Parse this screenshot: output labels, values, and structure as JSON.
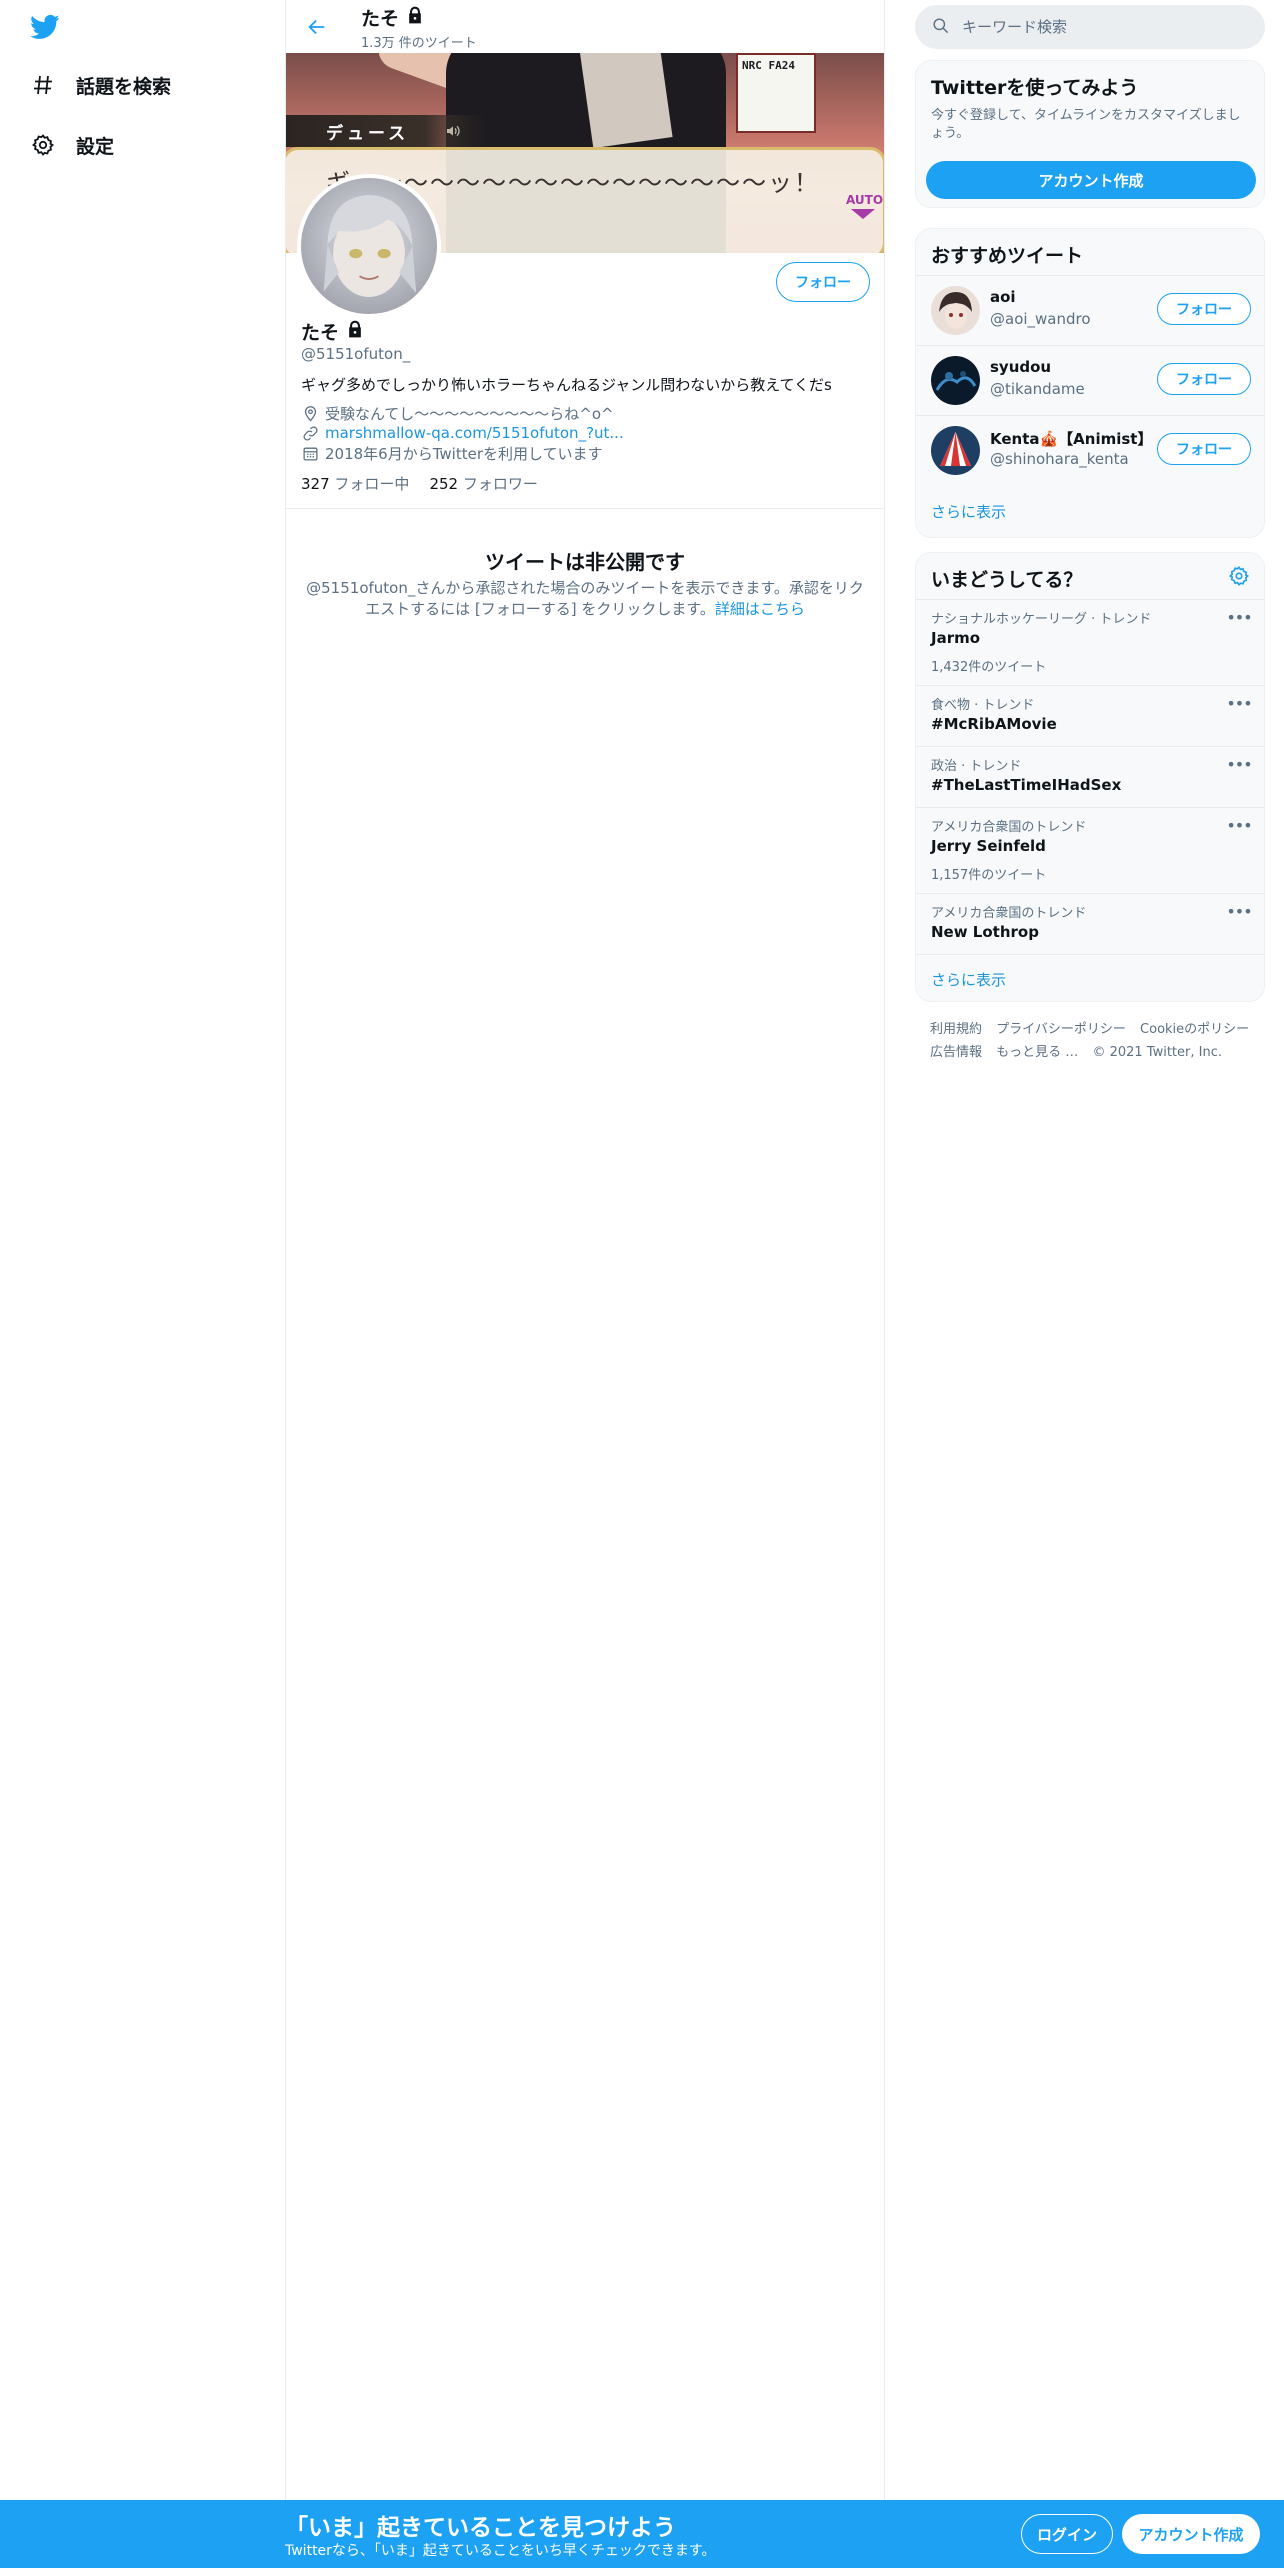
{
  "nav": {
    "logo_icon": "twitter-bird-icon",
    "items": [
      {
        "label": "話題を検索",
        "icon": "hashtag-icon"
      },
      {
        "label": "設定",
        "icon": "gear-icon"
      }
    ]
  },
  "header": {
    "name": "たそ",
    "tweet_count": "1.3万 件のツイート"
  },
  "banner": {
    "speaker": "デュース",
    "dialog": "ギ〜〜〜〜〜〜〜〜〜〜〜〜〜〜〜〜ッ！",
    "auto_label": "AUTO",
    "tag_text": "NRC FA24"
  },
  "profile": {
    "name": "たそ",
    "handle": "@5151ofuton_",
    "follow_label": "フォロー",
    "bio": "ギャグ多めでしっかり怖いホラーちゃんねるジャンル問わないから教えてくだs",
    "location": "受験なんてし〜〜〜〜〜〜〜〜〜らね^o^",
    "url": "marshmallow-qa.com/5151ofuton_?ut...",
    "joined": "2018年6月からTwitterを利用しています",
    "following_count": "327",
    "following_label": "フォロー中",
    "followers_count": "252",
    "followers_label": "フォロワー"
  },
  "private": {
    "title": "ツイートは非公開です",
    "desc": "@5151ofuton_さんから承認された場合のみツイートを表示できます。承認をリクエストするには [フォローする] をクリックします。",
    "link": "詳細はこちら"
  },
  "search": {
    "placeholder": "キーワード検索"
  },
  "signup_card": {
    "title": "Twitterを使ってみよう",
    "sub": "今すぐ登録して、タイムラインをカスタマイズしましょう。",
    "button": "アカウント作成"
  },
  "recommend": {
    "title": "おすすめツイート",
    "follow_label": "フォロー",
    "more": "さらに表示",
    "users": [
      {
        "name": "aoi",
        "handle": "@aoi_wandro"
      },
      {
        "name": "syudou",
        "handle": "@tikandame"
      },
      {
        "name": "Kenta🎪【Animist】",
        "handle": "@shinohara_kenta"
      }
    ]
  },
  "trends": {
    "title": "いまどうしてる？",
    "more": "さらに表示",
    "items": [
      {
        "context": "ナショナルホッケーリーグ · トレンド",
        "topic": "Jarmo",
        "count": "1,432件のツイート"
      },
      {
        "context": "食べ物 · トレンド",
        "topic": "#McRibAMovie",
        "count": ""
      },
      {
        "context": "政治 · トレンド",
        "topic": "#TheLastTimeIHadSex",
        "count": ""
      },
      {
        "context": "アメリカ合衆国のトレンド",
        "topic": "Jerry Seinfeld",
        "count": "1,157件のツイート"
      },
      {
        "context": "アメリカ合衆国のトレンド",
        "topic": "New Lothrop",
        "count": ""
      }
    ]
  },
  "footer": {
    "links": [
      "利用規約",
      "プライバシーポリシー",
      "Cookieのポリシー",
      "広告情報",
      "もっと見る …"
    ],
    "copyright": "© 2021 Twitter, Inc."
  },
  "bottom_bar": {
    "title": "「いま」起きていることを見つけよう",
    "sub": "Twitterなら、「いま」起きていることをいち早くチェックできます。",
    "login": "ログイン",
    "signup": "アカウント作成"
  },
  "colors": {
    "accent": "#1da1f2",
    "link": "#1b95e0",
    "muted": "#5b7083"
  }
}
